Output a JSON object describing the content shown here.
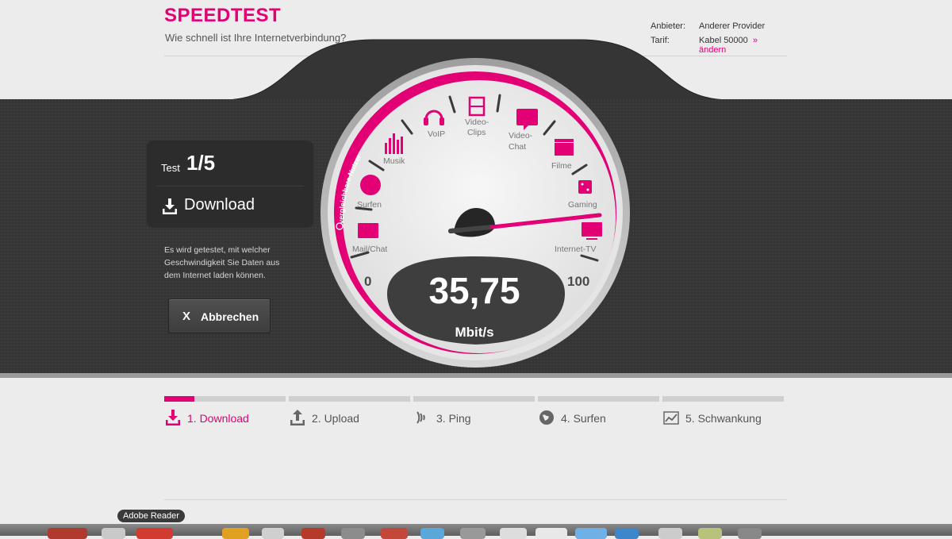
{
  "header": {
    "brand": "SPEEDTEST",
    "subtitle": "Wie schnell ist Ihre Internetverbindung?",
    "provider_label": "Anbieter:",
    "provider_value": "Anderer Provider",
    "tariff_label": "Tarif:",
    "tariff_value": "Kabel 50000",
    "change_link": "» ändern"
  },
  "test": {
    "label": "Test",
    "number": "1/5",
    "current_step": "Download",
    "description": "Es wird getestet, mit welcher Geschwindigkeit Sie Daten aus dem Internet laden können.",
    "cancel_x": "X",
    "cancel_label": "Abbrechen"
  },
  "gauge": {
    "value": "35,75",
    "unit": "Mbit/s",
    "scale_min": "0",
    "scale_max": "100",
    "arc_label": "vergleichbare Nutzer",
    "labels": {
      "mail": "Mail/Chat",
      "surfen": "Surfen",
      "musik": "Musik",
      "voip": "VoIP",
      "video_clips_1": "Video-",
      "video_clips_2": "Clips",
      "video_chat_1": "Video-",
      "video_chat_2": "Chat",
      "filme": "Filme",
      "gaming": "Gaming",
      "internet_tv": "Internet-TV"
    }
  },
  "steps": [
    {
      "label": "1. Download",
      "progress": 0.25,
      "active": true
    },
    {
      "label": "2. Upload",
      "progress": 0,
      "active": false
    },
    {
      "label": "3. Ping",
      "progress": 0,
      "active": false
    },
    {
      "label": "4. Surfen",
      "progress": 0,
      "active": false
    },
    {
      "label": "5. Schwankung",
      "progress": 0,
      "active": false
    }
  ],
  "dock": {
    "tooltip": "Adobe Reader"
  },
  "colors": {
    "accent": "#e20074",
    "dark_band": "#353535"
  }
}
